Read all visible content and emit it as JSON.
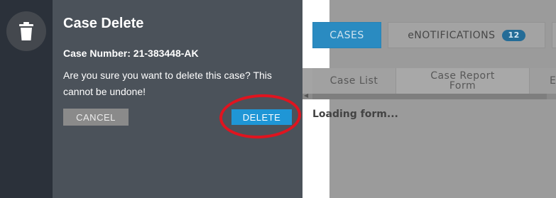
{
  "dialog": {
    "title": "Case Delete",
    "case_number": "Case Number: 21-383448-AK",
    "message": "Are you sure you want to delete this case? This cannot be undone!",
    "cancel_label": "CANCEL",
    "delete_label": "DELETE",
    "icon": "trash-icon"
  },
  "tabs": [
    {
      "label": "CASES",
      "active": true
    },
    {
      "label": "eNOTIFICATIONS",
      "badge": "12",
      "active": false
    }
  ],
  "subtabs": [
    {
      "label": "Case List"
    },
    {
      "label": "Case Report Form"
    },
    {
      "label": "E"
    }
  ],
  "main": {
    "loading_text": "Loading form..."
  },
  "colors": {
    "accent": "#1f96d6",
    "highlight": "#e0141f",
    "dialog_bg": "#4b525a"
  }
}
